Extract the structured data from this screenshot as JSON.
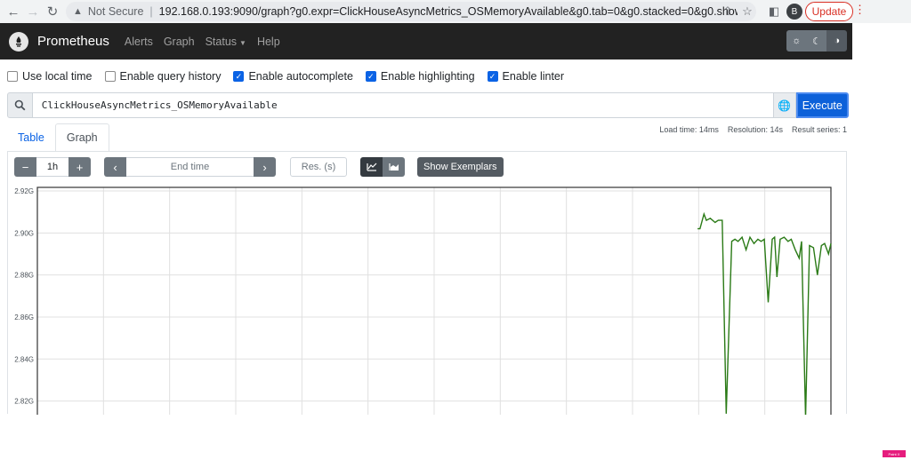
{
  "browser": {
    "security_label": "Not Secure",
    "url": "192.168.0.193:9090/graph?g0.expr=ClickHouseAsyncMetrics_OSMemoryAvailable&g0.tab=0&g0.stacked=0&g0.show_exemplars=0...",
    "avatar_letter": "B",
    "update_label": "Update"
  },
  "navbar": {
    "brand": "Prometheus",
    "links": [
      "Alerts",
      "Graph",
      "Status",
      "Help"
    ]
  },
  "options": [
    {
      "label": "Use local time",
      "checked": false
    },
    {
      "label": "Enable query history",
      "checked": false
    },
    {
      "label": "Enable autocomplete",
      "checked": true
    },
    {
      "label": "Enable highlighting",
      "checked": true
    },
    {
      "label": "Enable linter",
      "checked": true
    }
  ],
  "query": {
    "expression": "ClickHouseAsyncMetrics_OSMemoryAvailable",
    "execute_label": "Execute"
  },
  "tabs": [
    "Table",
    "Graph"
  ],
  "stats": {
    "load_time": "Load time: 14ms",
    "resolution": "Resolution: 14s",
    "result_series": "Result series: 1"
  },
  "controls": {
    "minus": "−",
    "range": "1h",
    "plus": "+",
    "end_time_placeholder": "End time",
    "res_placeholder": "Res. (s)",
    "show_exemplars_label": "Show Exemplars"
  },
  "colors": {
    "series": "#2a7a16",
    "execute": "#0d61d9",
    "navbar": "#222222"
  },
  "chart_data": {
    "type": "line",
    "ylim": [
      2.8135,
      2.9217
    ],
    "y_ticks": [
      "2.92G",
      "2.90G",
      "2.88G",
      "2.86G",
      "2.84G",
      "2.82G"
    ],
    "y_tick_values": [
      2.92,
      2.9,
      2.88,
      2.86,
      2.84,
      2.82
    ],
    "x_domain": [
      0,
      100
    ],
    "grid": true,
    "series": [
      {
        "x": [
          83.2,
          83.5,
          84.0,
          84.3,
          84.8,
          85.4,
          85.8,
          86.3,
          86.8,
          87.5,
          87.9,
          88.3,
          88.8,
          89.3,
          89.8,
          90.3,
          90.8,
          91.2,
          91.6,
          92.1,
          92.6,
          92.9,
          93.2,
          93.6,
          94.1,
          94.6,
          95.0,
          95.5,
          96.0,
          96.3,
          96.8,
          97.3,
          97.8,
          98.3,
          98.8,
          99.2,
          99.7,
          100.0
        ],
        "y": [
          2.902,
          2.902,
          2.909,
          2.906,
          2.907,
          2.905,
          2.906,
          2.906,
          2.814,
          2.896,
          2.897,
          2.896,
          2.898,
          2.892,
          2.898,
          2.895,
          2.897,
          2.896,
          2.897,
          2.867,
          2.897,
          2.898,
          2.879,
          2.897,
          2.898,
          2.896,
          2.897,
          2.892,
          2.888,
          2.896,
          2.812,
          2.894,
          2.893,
          2.88,
          2.894,
          2.895,
          2.89,
          2.895
        ]
      }
    ]
  }
}
